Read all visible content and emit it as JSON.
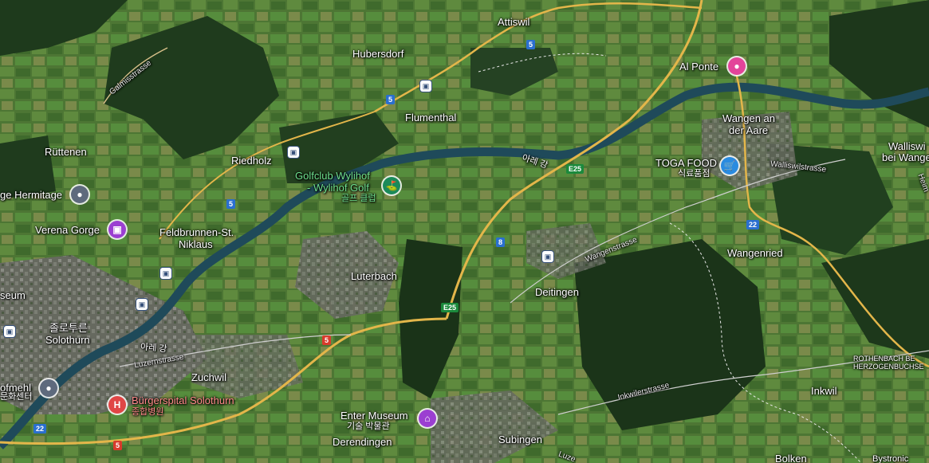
{
  "places": [
    {
      "key": "attiswil",
      "text": "Attiswil"
    },
    {
      "key": "hubersdorf",
      "text": "Hubersdorf"
    },
    {
      "key": "flumenthal",
      "text": "Flumenthal"
    },
    {
      "key": "al_ponte",
      "text": "Al Ponte"
    },
    {
      "key": "wangen_1",
      "text": "Wangen an"
    },
    {
      "key": "wangen_2",
      "text": "der Aare"
    },
    {
      "key": "walliswil_1",
      "text": "Walliswi"
    },
    {
      "key": "walliswil_2",
      "text": "bei Wange"
    },
    {
      "key": "ruttenen",
      "text": "Rüttenen"
    },
    {
      "key": "riedholz",
      "text": "Riedholz"
    },
    {
      "key": "hermitage",
      "text": "ge Hermitage"
    },
    {
      "key": "verena",
      "text": "Verena Gorge"
    },
    {
      "key": "feldbrunnen_1",
      "text": "Feldbrunnen-St."
    },
    {
      "key": "feldbrunnen_2",
      "text": "Niklaus"
    },
    {
      "key": "luterbach",
      "text": "Luterbach"
    },
    {
      "key": "deitingen",
      "text": "Deitingen"
    },
    {
      "key": "wangenried",
      "text": "Wangenried"
    },
    {
      "key": "seum",
      "text": "seum"
    },
    {
      "key": "solothurn_ko",
      "text": "졸로투른"
    },
    {
      "key": "solothurn",
      "text": "Solothurn"
    },
    {
      "key": "zuchwil",
      "text": "Zuchwil"
    },
    {
      "key": "ofmehl",
      "text": "ofmehl"
    },
    {
      "key": "munwha",
      "text": "문화센터"
    },
    {
      "key": "buergerspital",
      "text": "Bürgerspital Solothurn"
    },
    {
      "key": "buergerspital_ko",
      "text": "종합병원"
    },
    {
      "key": "enter_museum",
      "text": "Enter Museum"
    },
    {
      "key": "museum_ko",
      "text": "기술 박물관"
    },
    {
      "key": "derendingen",
      "text": "Derendingen"
    },
    {
      "key": "subingen",
      "text": "Subingen"
    },
    {
      "key": "inkwil",
      "text": "Inkwil"
    },
    {
      "key": "bolken",
      "text": "Bolken"
    },
    {
      "key": "bystronic",
      "text": "Bystronic"
    },
    {
      "key": "rothenbach_1",
      "text": "ROTHENBACH BE"
    },
    {
      "key": "rothenbach_2",
      "text": "HERZOGENBUCHSE"
    },
    {
      "key": "golf_1",
      "text": "Golfclub Wylihof"
    },
    {
      "key": "golf_2",
      "text": "- Wylihof Golf"
    },
    {
      "key": "golf_ko",
      "text": "골프 클럽"
    },
    {
      "key": "toga",
      "text": "TOGA FOOD"
    },
    {
      "key": "toga_ko",
      "text": "식료품점"
    },
    {
      "key": "aare_1",
      "text": "아레 강"
    },
    {
      "key": "aare_2",
      "text": "아레 강"
    },
    {
      "key": "gallerstrasse",
      "text": "Galmisstrasse"
    },
    {
      "key": "wangenstrasse",
      "text": "Wangenstrasse"
    },
    {
      "key": "walliswilstrasse",
      "text": "Walliswilstrasse"
    },
    {
      "key": "inkwilerstrasse",
      "text": "Inkwilerstrasse"
    },
    {
      "key": "luzernstrasse",
      "text": "Luzernstrasse"
    },
    {
      "key": "heimen",
      "text": "Heim"
    },
    {
      "key": "luzern_2",
      "text": "Luze"
    }
  ],
  "shields": {
    "s5a": "5",
    "s5b": "5",
    "s5c": "5",
    "s5d": "5",
    "s5e": "5",
    "s8": "8",
    "s22a": "22",
    "s22b": "22",
    "e25a": "E25",
    "e25b": "E25"
  },
  "pins": {
    "hospital": "H"
  },
  "colors": {
    "water": "#1f4a5a",
    "road": "#e3b64a",
    "town": "#6b6f6a",
    "forest": "#1e3a1c",
    "field": "#4f7a36"
  }
}
